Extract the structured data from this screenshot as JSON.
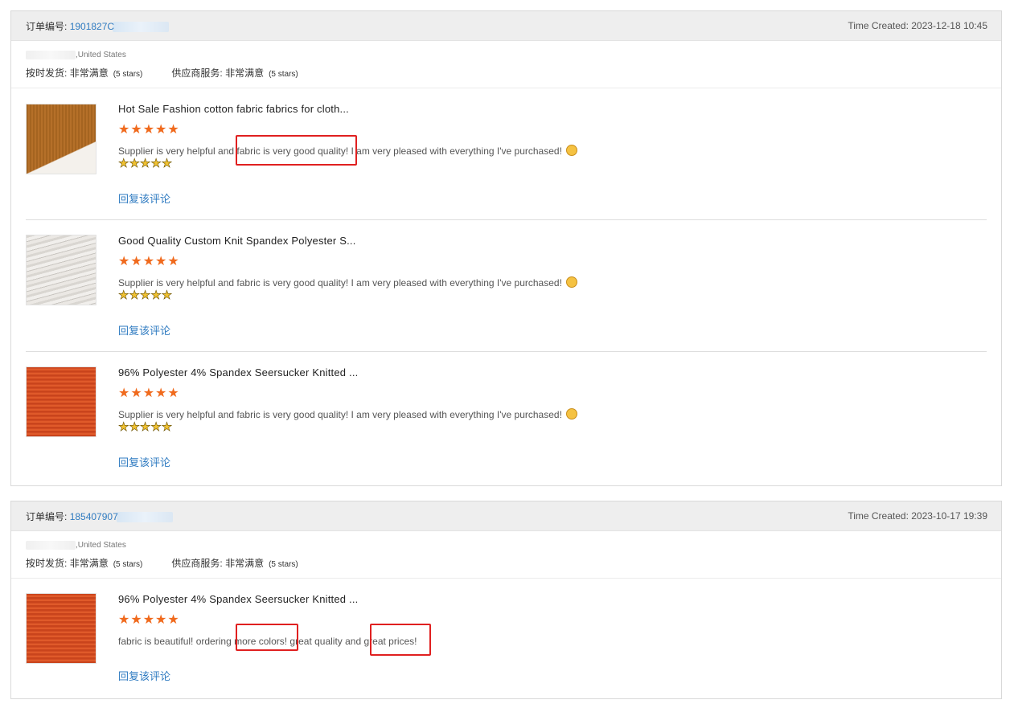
{
  "labels": {
    "order_no": "订单编号:",
    "on_time": "按时发货:",
    "supplier_service": "供应商服务:",
    "reply": "回复该评论"
  },
  "orders": [
    {
      "order_no": "1901827C",
      "time_created": "Time Created: 2023-12-18 10:45",
      "country": ",United States",
      "on_time_value": "非常满意",
      "on_time_stars": "(5 stars)",
      "service_value": "非常满意",
      "service_stars": "(5 stars)",
      "items": [
        {
          "title": "Hot Sale Fashion cotton fabric fabrics for cloth...",
          "comment": "Supplier is very helpful and fabric is very good quality! I am very pleased with everything I've purchased!",
          "rating": 5
        },
        {
          "title": "Good Quality Custom Knit Spandex Polyester S...",
          "comment": "Supplier is very helpful and fabric is very good quality! I am very pleased with everything I've purchased!",
          "rating": 5
        },
        {
          "title": "96% Polyester 4% Spandex Seersucker Knitted ...",
          "comment": "Supplier is very helpful and fabric is very good quality! I am very pleased with everything I've purchased!",
          "rating": 5
        }
      ]
    },
    {
      "order_no": "185407907",
      "time_created": "Time Created: 2023-10-17 19:39",
      "country": ",United States",
      "on_time_value": "非常满意",
      "on_time_stars": "(5 stars)",
      "service_value": "非常满意",
      "service_stars": "(5 stars)",
      "items": [
        {
          "title": "96% Polyester 4% Spandex Seersucker Knitted ...",
          "comment": "fabric is beautiful! ordering more colors! great quality and great prices!",
          "rating": 5
        }
      ]
    }
  ],
  "star_glyphs": {
    "orange": "★★★★★",
    "yellow": "★★★★★"
  },
  "colors": {
    "link": "#2f7bc1",
    "star_orange": "#f06a1d",
    "highlight": "#e02020"
  }
}
